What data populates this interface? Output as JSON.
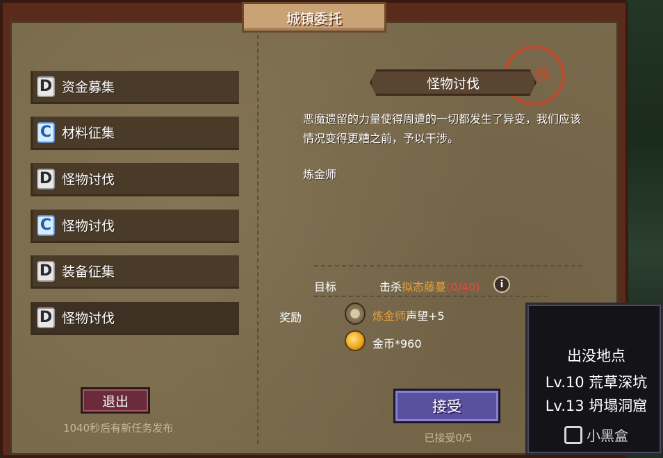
{
  "window": {
    "title": "城镇委托"
  },
  "quests": [
    {
      "rank": "D",
      "label": "资金募集"
    },
    {
      "rank": "C",
      "label": "材料征集"
    },
    {
      "rank": "D",
      "label": "怪物讨伐"
    },
    {
      "rank": "C",
      "label": "怪物讨伐"
    },
    {
      "rank": "D",
      "label": "装备征集"
    },
    {
      "rank": "D",
      "label": "怪物讨伐"
    }
  ],
  "exit_button": "退出",
  "refresh_note": "1040秒后有新任务发布",
  "detail": {
    "title": "怪物讨伐",
    "stamp": "讨伐",
    "description": "恶魔遗留的力量使得周遭的一切都发生了异变，我们应该情况变得更糟之前，予以干涉。",
    "giver": "炼金师",
    "target_label": "目标",
    "target_prefix": "击杀",
    "target_monster": "拟态藤蔓",
    "target_progress": "(0/40)",
    "info_icon": "i",
    "reward_label": "奖励",
    "reward_1_name": "炼金师",
    "reward_1_text": "声望+5",
    "reward_2_text": "金币*960",
    "accept_button": "接受",
    "accepted_count": "已接受0/5"
  },
  "tooltip": {
    "title": "出没地点",
    "location_1": "Lv.10 荒草深坑",
    "location_2": "Lv.13 坍塌洞窟"
  },
  "watermark": "小黑盒",
  "icons": {
    "rank_badge": "rank-letter-icon",
    "reputation": "medal-icon",
    "gold": "coin-icon",
    "info": "info-icon"
  },
  "colors": {
    "highlight": "#e8a23a",
    "progress": "#e84a3a",
    "accept": "#5a50a0",
    "exit": "#6a2c3a"
  }
}
